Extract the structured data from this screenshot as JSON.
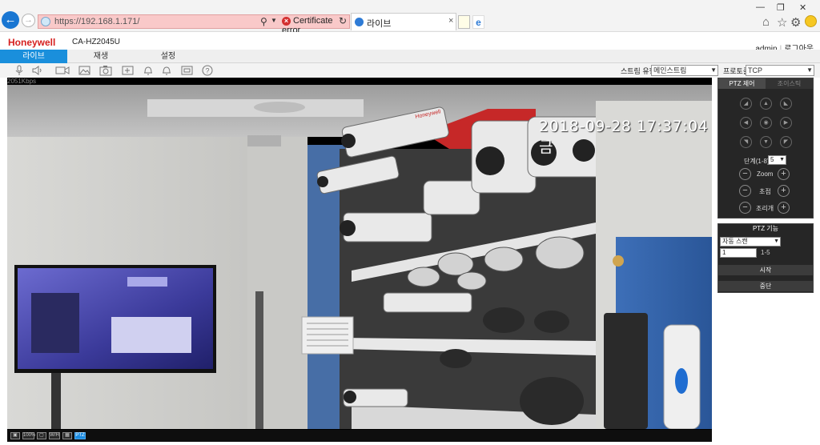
{
  "browser": {
    "url": "https://192.168.1.171/",
    "cert_error": "Certificate error",
    "tab_title": "라이브"
  },
  "header": {
    "brand": "Honeywell",
    "model": "CA-HZ2045U",
    "user": "admin",
    "logout": "로그아웃"
  },
  "menu": [
    "라이브",
    "재생",
    "설정"
  ],
  "toolbar": {
    "stream_type_label": "스트림 유형",
    "stream_type_value": "메인스트림",
    "protocol_label": "프로토콜",
    "protocol_value": "TCP"
  },
  "video": {
    "bitrate": "2051Kbps",
    "timestamp": "2018-09-28 17:37:04 금",
    "status_buttons": [
      "100%",
      "W/H",
      "PTZ"
    ],
    "ptz_active": true
  },
  "ptz": {
    "tab_control": "PTZ 제어",
    "tab_joystick": "조이스틱",
    "step_label": "단계(1-8):",
    "step_value": "5",
    "zoom_label": "Zoom",
    "focus_label": "초점",
    "iris_label": "조리개"
  },
  "ptz_function": {
    "title": "PTZ 기능",
    "mode_value": "자동 스캔",
    "number_value": "1",
    "range": "1-5",
    "start": "시작",
    "stop": "중단"
  },
  "colors": {
    "accent": "#1a8fdc",
    "brand": "#d6201f",
    "address_error": "#f9c9c9"
  }
}
